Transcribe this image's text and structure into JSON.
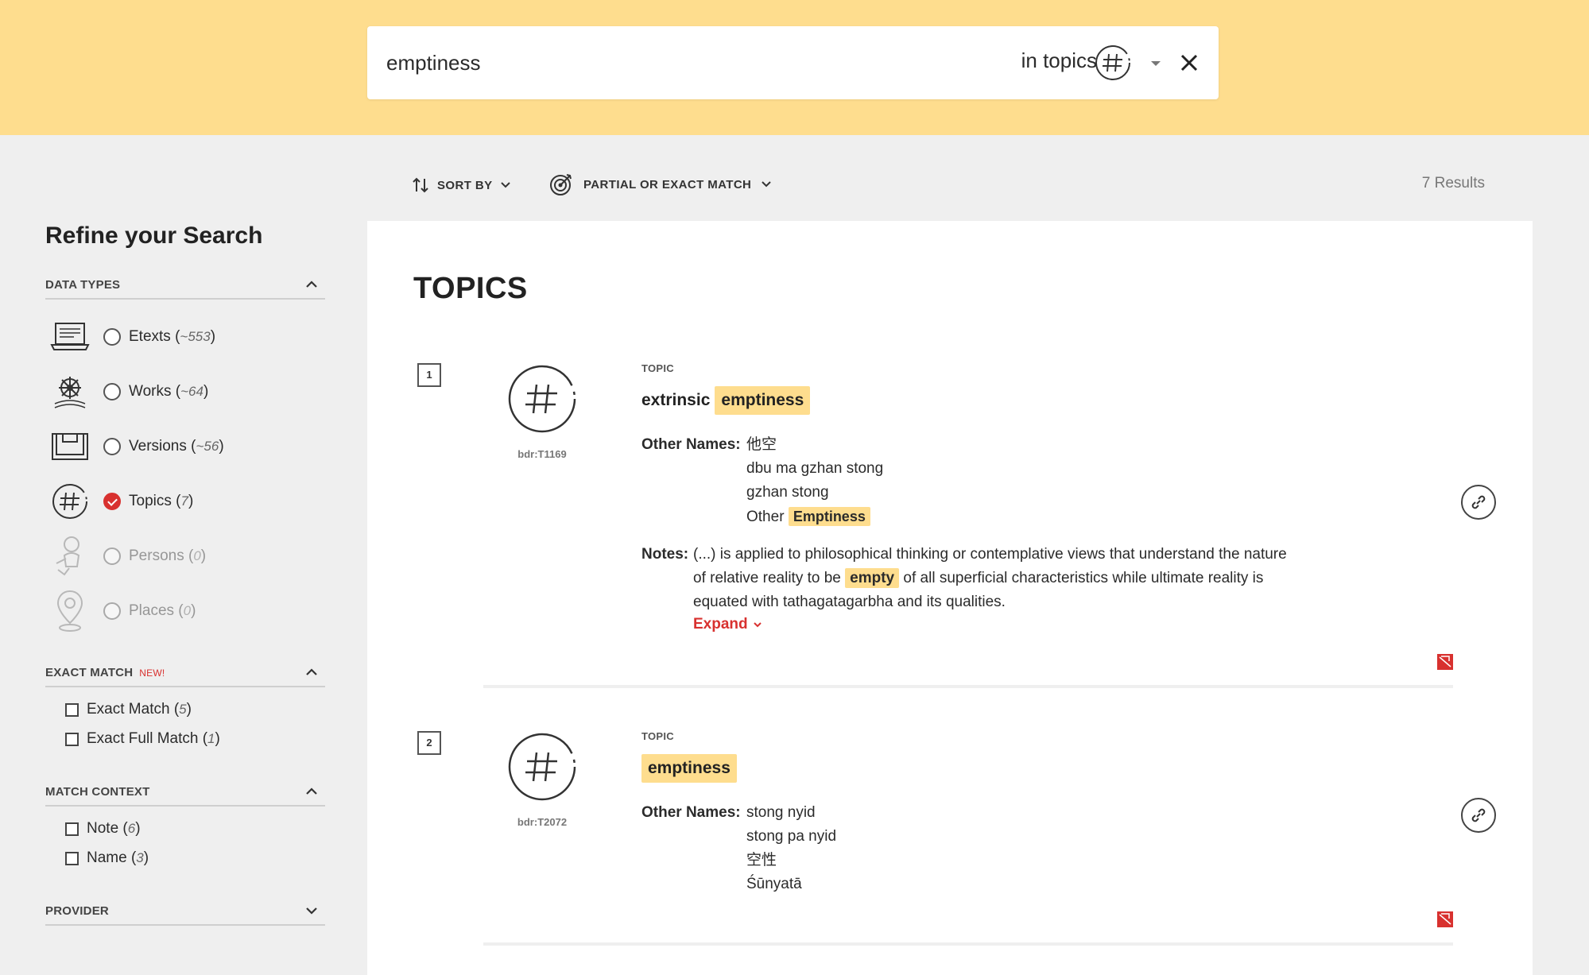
{
  "search": {
    "query": "emptiness",
    "scope_label": "in topics",
    "scope_icon": "hashtag-icon"
  },
  "toolbar": {
    "sort_label": "SORT BY",
    "match_label": "PARTIAL OR EXACT MATCH",
    "result_count": "7 Results"
  },
  "sidebar": {
    "title": "Refine your Search",
    "data_types": {
      "heading": "DATA TYPES",
      "items": [
        {
          "label": "Etexts",
          "count": "~553",
          "icon": "laptop-icon",
          "selected": false,
          "enabled": true
        },
        {
          "label": "Works",
          "count": "~64",
          "icon": "dharma-wheel-icon",
          "selected": false,
          "enabled": true
        },
        {
          "label": "Versions",
          "count": "~56",
          "icon": "book-stack-icon",
          "selected": false,
          "enabled": true
        },
        {
          "label": "Topics",
          "count": "7",
          "icon": "hashtag-icon",
          "selected": true,
          "enabled": true
        },
        {
          "label": "Persons",
          "count": "0",
          "icon": "person-icon",
          "selected": false,
          "enabled": false
        },
        {
          "label": "Places",
          "count": "0",
          "icon": "map-pin-icon",
          "selected": false,
          "enabled": false
        }
      ]
    },
    "exact_match": {
      "heading": "EXACT MATCH",
      "badge": "NEW!",
      "items": [
        {
          "label": "Exact Match",
          "count": "5"
        },
        {
          "label": "Exact Full Match",
          "count": "1"
        }
      ]
    },
    "match_context": {
      "heading": "MATCH CONTEXT",
      "items": [
        {
          "label": "Note",
          "count": "6"
        },
        {
          "label": "Name",
          "count": "3"
        }
      ]
    },
    "provider": {
      "heading": "PROVIDER"
    }
  },
  "main": {
    "section_title": "TOPICS",
    "results": [
      {
        "number": "1",
        "id": "bdr:T1169",
        "kind": "TOPIC",
        "title_prefix": "extrinsic",
        "title_match": "emptiness",
        "other_names_label": "Other Names:",
        "other_names": [
          "他空",
          "dbu ma gzhan stong",
          "gzhan stong"
        ],
        "other_name_last_prefix": "Other",
        "other_name_last_match": "Emptiness",
        "notes_label": "Notes:",
        "notes_line1": "(...) is applied to philosophical thinking or contemplative views that understand the nature",
        "notes_line2_before": "of relative reality to be",
        "notes_line2_match": "empty",
        "notes_line2_after": "of all superficial characteristics while ultimate reality is",
        "notes_line3": "equated with tathagatagarbha and its qualities.",
        "expand_label": "Expand"
      },
      {
        "number": "2",
        "id": "bdr:T2072",
        "kind": "TOPIC",
        "title_match": "emptiness",
        "other_names_label": "Other Names:",
        "other_names": [
          "stong nyid",
          "stong pa nyid",
          "空性",
          "Śūnyatā"
        ]
      }
    ]
  },
  "colors": {
    "header_bg": "#fedd8e",
    "highlight": "#fedd8e",
    "accent_red": "#d8312f",
    "page_bg": "#efefef"
  }
}
